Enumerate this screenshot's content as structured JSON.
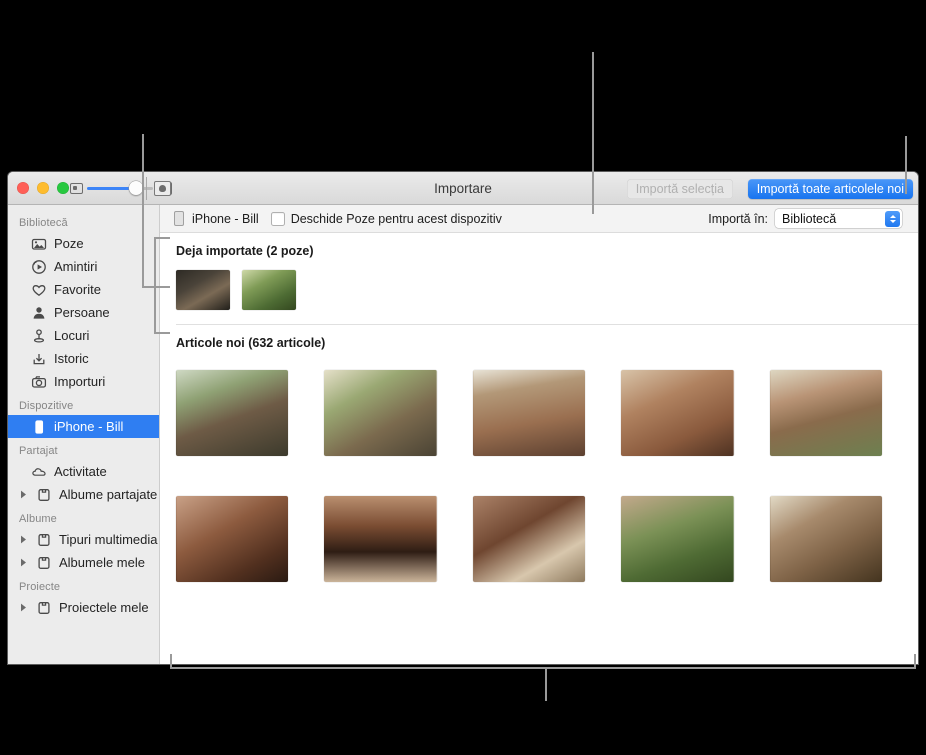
{
  "window": {
    "title": "Importare",
    "traffic_lights": [
      "close-button",
      "minimize-button",
      "maximize-button"
    ],
    "zoom_slider": {
      "name": "thumbnail-size-slider",
      "value": "65"
    },
    "toolbar_buttons": {
      "import_selection": "Importă selecția",
      "import_all_new": "Importă toate articolele noi"
    }
  },
  "sidebar": {
    "sections": [
      {
        "header": "Bibliotecă",
        "items": [
          {
            "label": "Poze",
            "icon": "photos-icon",
            "twisty": false,
            "selected": false
          },
          {
            "label": "Amintiri",
            "icon": "memories-icon",
            "twisty": false,
            "selected": false
          },
          {
            "label": "Favorite",
            "icon": "heart-icon",
            "twisty": false,
            "selected": false
          },
          {
            "label": "Persoane",
            "icon": "person-icon",
            "twisty": false,
            "selected": false
          },
          {
            "label": "Locuri",
            "icon": "places-pin-icon",
            "twisty": false,
            "selected": false
          },
          {
            "label": "Istoric",
            "icon": "recents-download-icon",
            "twisty": false,
            "selected": false
          },
          {
            "label": "Importuri",
            "icon": "imports-camera-icon",
            "twisty": false,
            "selected": false
          }
        ]
      },
      {
        "header": "Dispozitive",
        "items": [
          {
            "label": "iPhone - Bill",
            "icon": "iphone-icon",
            "twisty": false,
            "selected": true
          }
        ]
      },
      {
        "header": "Partajat",
        "items": [
          {
            "label": "Activitate",
            "icon": "cloud-icon",
            "twisty": false,
            "selected": false
          },
          {
            "label": "Albume partajate",
            "icon": "album-icon",
            "twisty": true,
            "selected": false
          }
        ]
      },
      {
        "header": "Albume",
        "items": [
          {
            "label": "Tipuri multimedia",
            "icon": "album-icon",
            "twisty": true,
            "selected": false
          },
          {
            "label": "Albumele mele",
            "icon": "album-icon",
            "twisty": true,
            "selected": false
          }
        ]
      },
      {
        "header": "Proiecte",
        "items": [
          {
            "label": "Proiectele mele",
            "icon": "album-icon",
            "twisty": true,
            "selected": false
          }
        ]
      }
    ]
  },
  "device_bar": {
    "device_name": "iPhone - Bill",
    "checkbox_label": "Deschide Poze pentru acest dispozitiv",
    "checkbox_checked": false,
    "import_to_label": "Importă în:",
    "import_to_value": "Bibliotecă",
    "import_to_options": [
      "Bibliotecă"
    ]
  },
  "main": {
    "already_imported": {
      "title": "Deja importate (2 poze)",
      "thumbs": [
        "pa",
        "pb"
      ]
    },
    "new_items": {
      "title": "Articole noi (632 articole)",
      "rows": [
        [
          "p1",
          "p2",
          "p3",
          "p4",
          "p5"
        ],
        [
          "p6",
          "p7",
          "p8",
          "p9",
          "p10"
        ]
      ]
    }
  },
  "colors": {
    "accent_blue": "#1874ef",
    "selection_blue": "#2f7ef2",
    "sidebar_bg": "#ececec",
    "callout_gray": "#9a9a9a"
  }
}
